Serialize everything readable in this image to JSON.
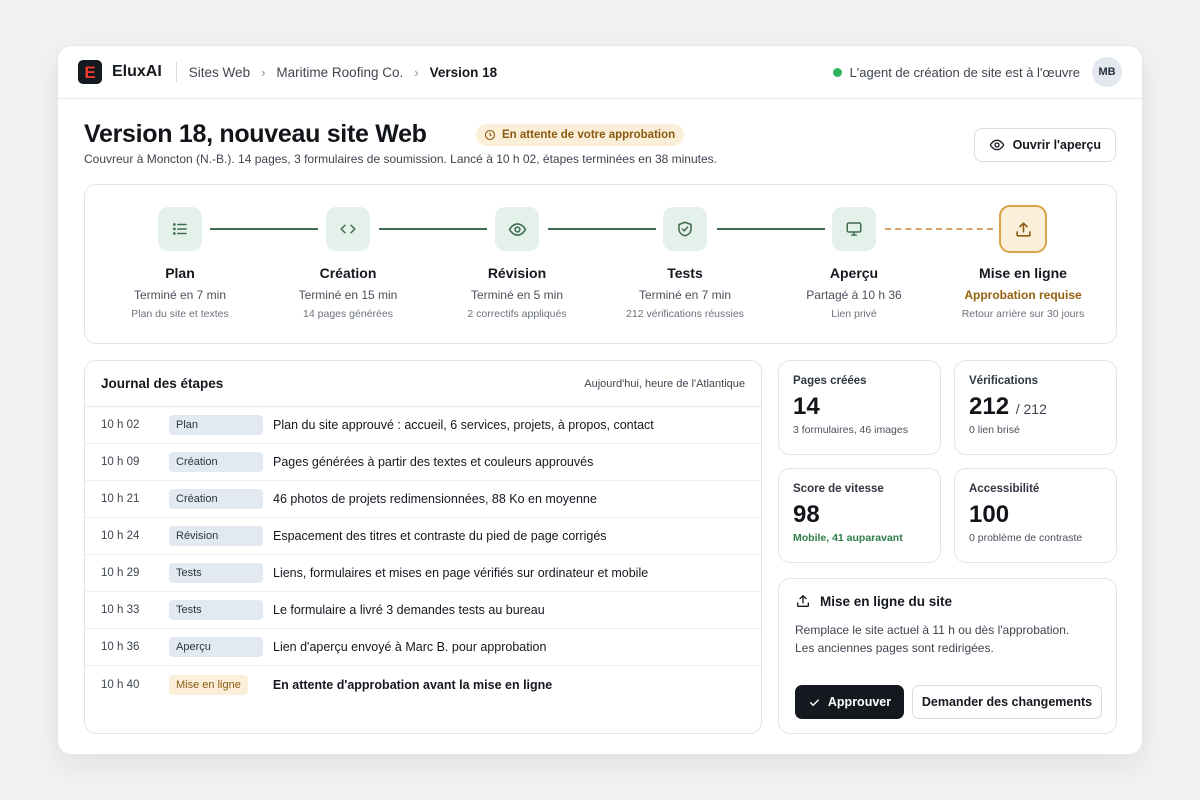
{
  "topbar": {
    "logo_letter": "E",
    "brand": "EluxAI",
    "breadcrumbs": [
      "Sites Web",
      "Maritime Roofing Co.",
      "Version 18"
    ],
    "status_text": "L'agent de création de site est à l'œuvre",
    "status_color": "#2fb35f",
    "avatar_initials": "MB"
  },
  "header": {
    "title": "Version 18, nouveau site Web",
    "badge": "En attente de votre approbation",
    "subtitle": "Couvreur à Moncton (N.-B.). 14 pages, 3 formulaires de soumission. Lancé à 10 h 02, étapes terminées en 38 minutes.",
    "preview_button": "Ouvrir l'aperçu"
  },
  "steps": [
    {
      "name": "Plan",
      "status": "Terminé en 7 min",
      "detail": "Plan du site et textes",
      "icon": "list-icon"
    },
    {
      "name": "Création",
      "status": "Terminé en 15 min",
      "detail": "14 pages générées",
      "icon": "code-icon"
    },
    {
      "name": "Révision",
      "status": "Terminé en 5 min",
      "detail": "2 correctifs appliqués",
      "icon": "eye-icon"
    },
    {
      "name": "Tests",
      "status": "Terminé en 7 min",
      "detail": "212 vérifications réussies",
      "icon": "shield-check-icon"
    },
    {
      "name": "Aperçu",
      "status": "Partagé à 10 h 36",
      "detail": "Lien privé",
      "icon": "monitor-icon"
    },
    {
      "name": "Mise en ligne",
      "status": "Approbation requise",
      "detail": "Retour arrière sur 30 jours",
      "icon": "upload-icon"
    }
  ],
  "log": {
    "title": "Journal des étapes",
    "timezone": "Aujourd'hui, heure de l'Atlantique",
    "rows": [
      {
        "time": "10 h 02",
        "tag": "Plan",
        "text": "Plan du site approuvé : accueil, 6 services, projets, à propos, contact"
      },
      {
        "time": "10 h 09",
        "tag": "Création",
        "text": "Pages générées à partir des textes et couleurs approuvés"
      },
      {
        "time": "10 h 21",
        "tag": "Création",
        "text": "46 photos de projets redimensionnées, 88 Ko en moyenne"
      },
      {
        "time": "10 h 24",
        "tag": "Révision",
        "text": "Espacement des titres et contraste du pied de page corrigés"
      },
      {
        "time": "10 h 29",
        "tag": "Tests",
        "text": "Liens, formulaires et mises en page vérifiés sur ordinateur et mobile"
      },
      {
        "time": "10 h 33",
        "tag": "Tests",
        "text": "Le formulaire a livré 3 demandes tests au bureau"
      },
      {
        "time": "10 h 36",
        "tag": "Aperçu",
        "text": "Lien d'aperçu envoyé à Marc B. pour approbation"
      },
      {
        "time": "10 h 40",
        "tag": "Mise en ligne",
        "text": "En attente d'approbation avant la mise en ligne"
      }
    ]
  },
  "stats": {
    "pages": {
      "label": "Pages créées",
      "value": "14",
      "sub": "3 formulaires, 46 images"
    },
    "checks": {
      "label": "Vérifications",
      "value": "212",
      "total": "/ 212",
      "sub": "0 lien brisé"
    },
    "speed": {
      "label": "Score de vitesse",
      "value": "98",
      "sub": "Mobile, 41 auparavant"
    },
    "a11y": {
      "label": "Accessibilité",
      "value": "100",
      "sub": "0 problème de contraste"
    }
  },
  "publish": {
    "title": "Mise en ligne du site",
    "line1": "Remplace le site actuel à 11 h ou dès l'approbation.",
    "line2": "Les anciennes pages sont redirigées.",
    "approve": "Approuver",
    "changes": "Demander des changements"
  },
  "colors": {
    "accent_green": "#3f6b4e",
    "step_bg": "#e4f1ea",
    "pending_amber": "#d9a347",
    "dark": "#14181f"
  }
}
